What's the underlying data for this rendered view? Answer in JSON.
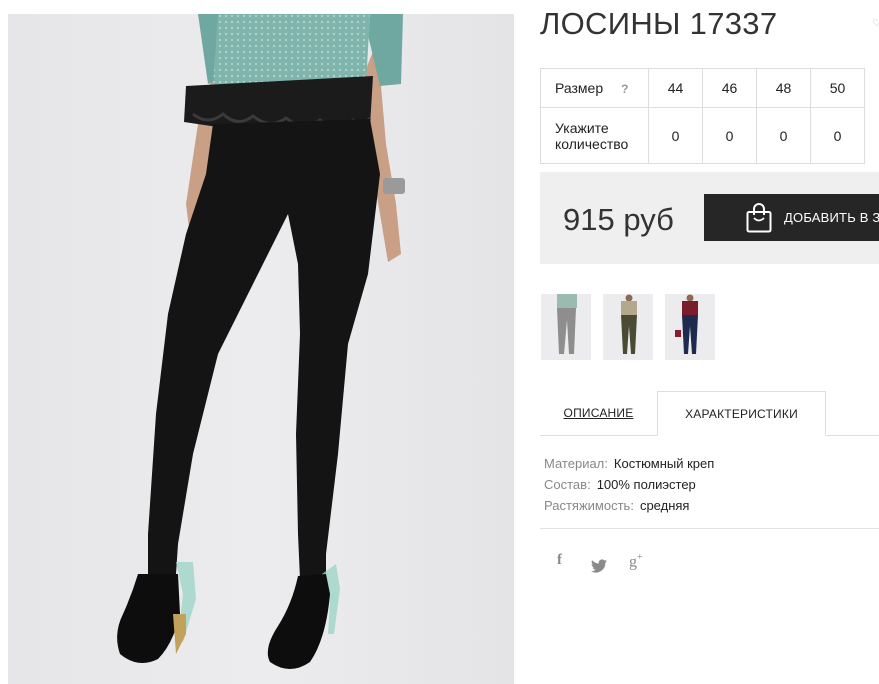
{
  "product": {
    "title": "ЛОСИНЫ 17337",
    "price": "915 руб",
    "add_to_cart_label": "ДОБАВИТЬ В ЗА"
  },
  "size_table": {
    "size_label": "Размер",
    "help": "?",
    "qty_label_line1": "Укажите",
    "qty_label_line2": "количество",
    "sizes": [
      "44",
      "46",
      "48",
      "50"
    ],
    "quantities": [
      "0",
      "0",
      "0",
      "0"
    ]
  },
  "thumbnails": [
    {
      "name": "thumb-gray",
      "pants_color": "#8e8e8e",
      "top_color": "#9bbab0"
    },
    {
      "name": "thumb-olive",
      "pants_color": "#4b4a33",
      "top_color": "#b4a88c"
    },
    {
      "name": "thumb-navy",
      "pants_color": "#1f2a4f",
      "top_color": "#7b1e2c"
    }
  ],
  "tabs": [
    {
      "label": "ОПИСАНИЕ",
      "active": false
    },
    {
      "label": "ХАРАКТЕРИСТИКИ",
      "active": true
    }
  ],
  "specs": [
    {
      "key": "Материал:",
      "value": "Костюмный креп"
    },
    {
      "key": "Состав:",
      "value": "100% полиэстер"
    },
    {
      "key": "Растяжимость:",
      "value": "средняя"
    }
  ],
  "social": [
    {
      "icon": "facebook-icon",
      "glyph": "f"
    },
    {
      "icon": "twitter-icon",
      "glyph": "🐦"
    },
    {
      "icon": "google-plus-icon",
      "glyph": "g+"
    }
  ],
  "colors": {
    "button_bg": "#262626",
    "price_box_bg": "#efefef",
    "top_teal": "#6fa8a0",
    "pants_black": "#141414"
  }
}
